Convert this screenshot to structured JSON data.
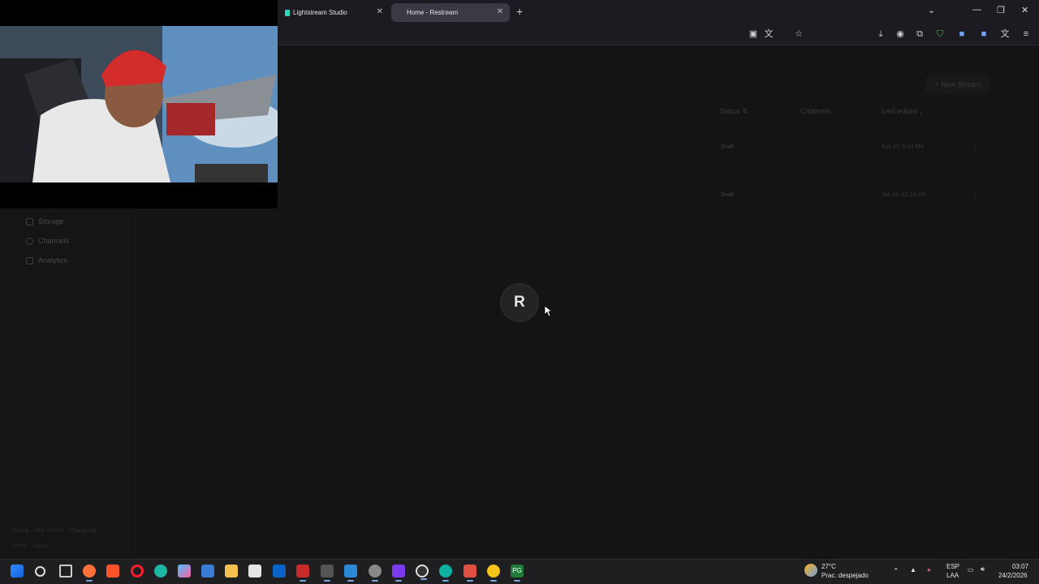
{
  "browser": {
    "tabs": [
      {
        "title": "Lightstream Studio",
        "active": false
      },
      {
        "title": "Home - Restream",
        "active": true
      }
    ],
    "close_glyph": "✕",
    "new_tab_glyph": "+",
    "window_controls": {
      "list": "⌄",
      "minimize": "—",
      "restore": "❐",
      "close": "✕"
    }
  },
  "sidebar": {
    "items": [
      {
        "label": "Storage",
        "icon": "storage-icon"
      },
      {
        "label": "Channels",
        "icon": "channels-icon"
      },
      {
        "label": "Analytics",
        "icon": "analytics-icon"
      }
    ],
    "footer_line1": "Pricing · Help Centre · Changelog",
    "footer_line2": "Terms · Status"
  },
  "main": {
    "new_stream_label": "+ New Stream",
    "columns": {
      "status": "Status ⇅",
      "channels": "Channels",
      "last_edited": "Last edited ↓"
    },
    "rows": [
      {
        "status": "Draft",
        "last_edited": "Feb 10, 5:24 PM"
      },
      {
        "status": "Draft",
        "last_edited": "Jan 24, 12:13 AM"
      }
    ],
    "more_glyph": "⋮"
  },
  "loader": {
    "letter": "R"
  },
  "taskbar": {
    "weather_temp": "27°C",
    "weather_desc": "Prac. despejado",
    "lang_top": "ESP",
    "lang_bottom": "LAA",
    "time": "03:07",
    "date": "24/2/2026"
  },
  "colors": {
    "accent": "#2dd4bf",
    "loader_bg": "#232323",
    "page_bg": "#141414"
  }
}
